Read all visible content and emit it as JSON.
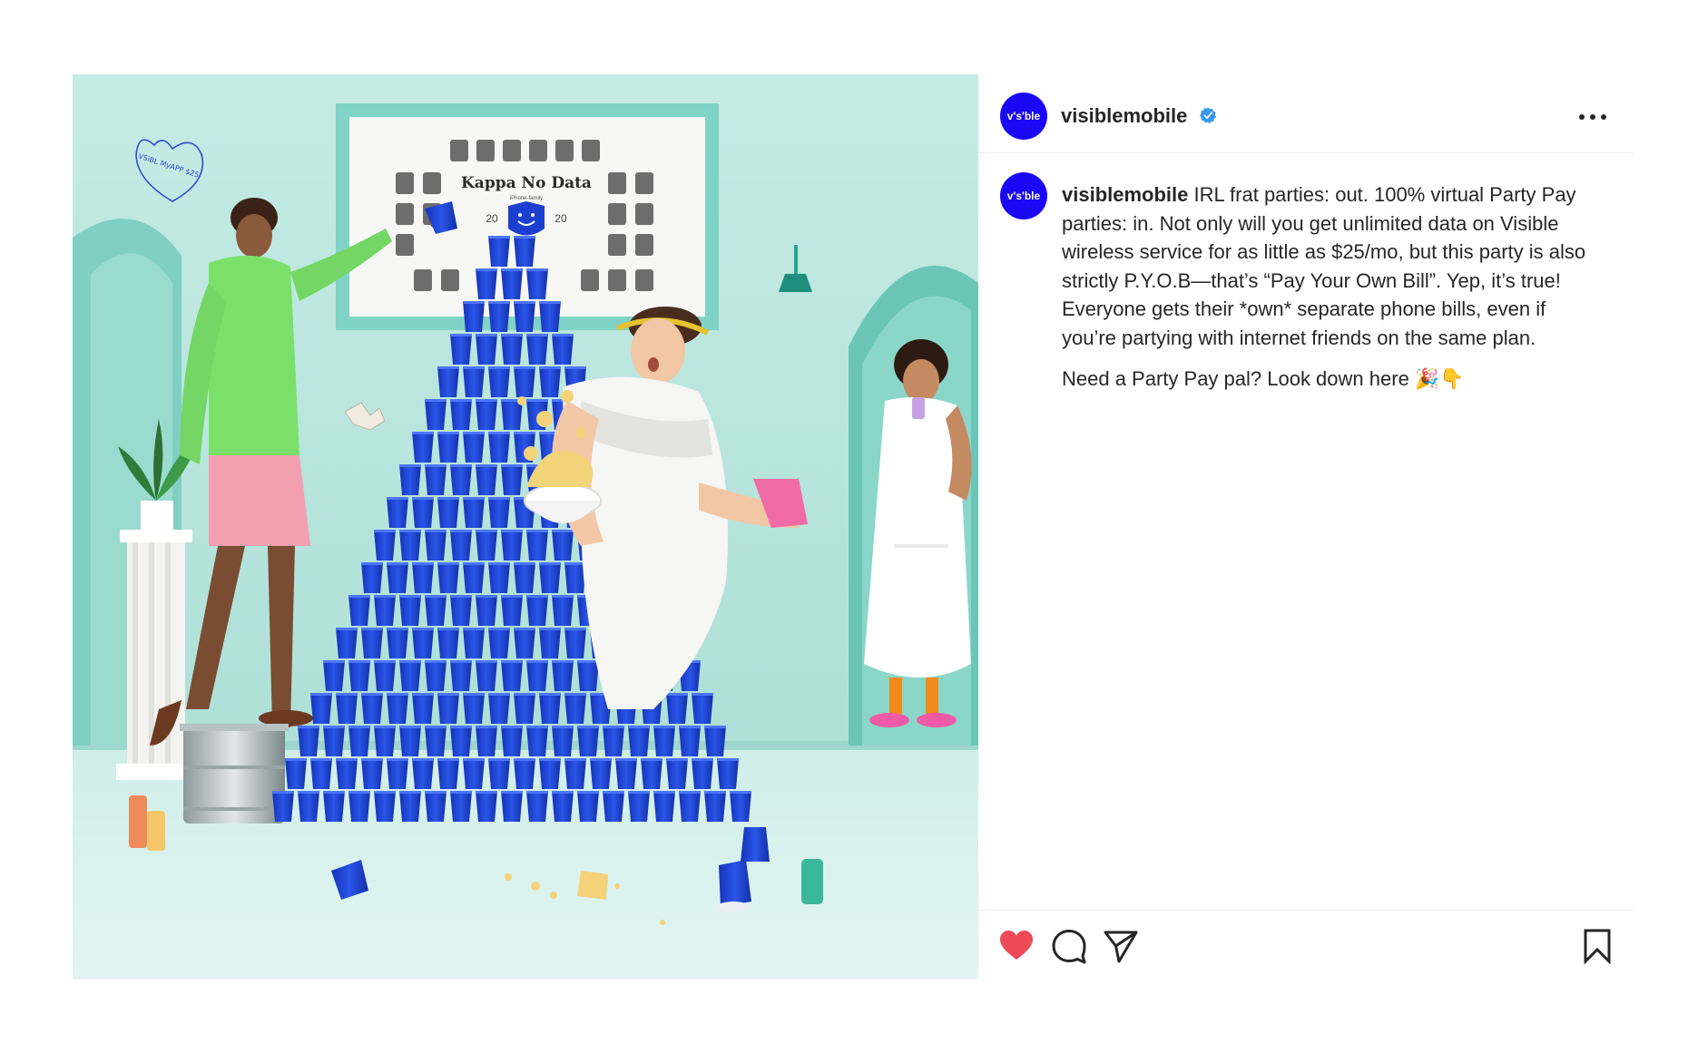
{
  "post": {
    "image_alt": "Party scene with a pyramid of blue cups",
    "header": {
      "avatar_text": "v's'ble",
      "username": "visiblemobile",
      "verified": true,
      "more_icon": "more-horizontal-icon"
    },
    "caption": {
      "avatar_text": "v's'ble",
      "username": "visiblemobile",
      "text": "IRL frat parties: out. 100% virtual Party Pay parties: in. Not only will you get unlimited data on Visible wireless service for as little as $25/mo, but this party is also strictly P.Y.O.B—that’s “Pay Your Own Bill”. Yep, it’s true! Everyone gets their *own* separate phone bills, even if you’re partying with internet friends on the same plan.",
      "second_paragraph": "Need a Party Pay pal? Look down here 🎉👇"
    },
    "poster_board": {
      "title": "Kappa No Data",
      "subtitle": "iPhone-family",
      "year_left": "20",
      "year_right": "20"
    },
    "wall_doodle": "VSiBL MyAPP $25",
    "actions": {
      "like_icon": "heart-filled-icon",
      "comment_icon": "comment-bubble-icon",
      "share_icon": "paper-plane-icon",
      "save_icon": "bookmark-icon",
      "liked": true
    }
  },
  "colors": {
    "brand_blue": "#1a08f5",
    "like_red": "#ed4956",
    "verified_blue": "#3897f0",
    "cup_blue": "#1c3fcf",
    "wall_teal": "#bfe6e0"
  }
}
